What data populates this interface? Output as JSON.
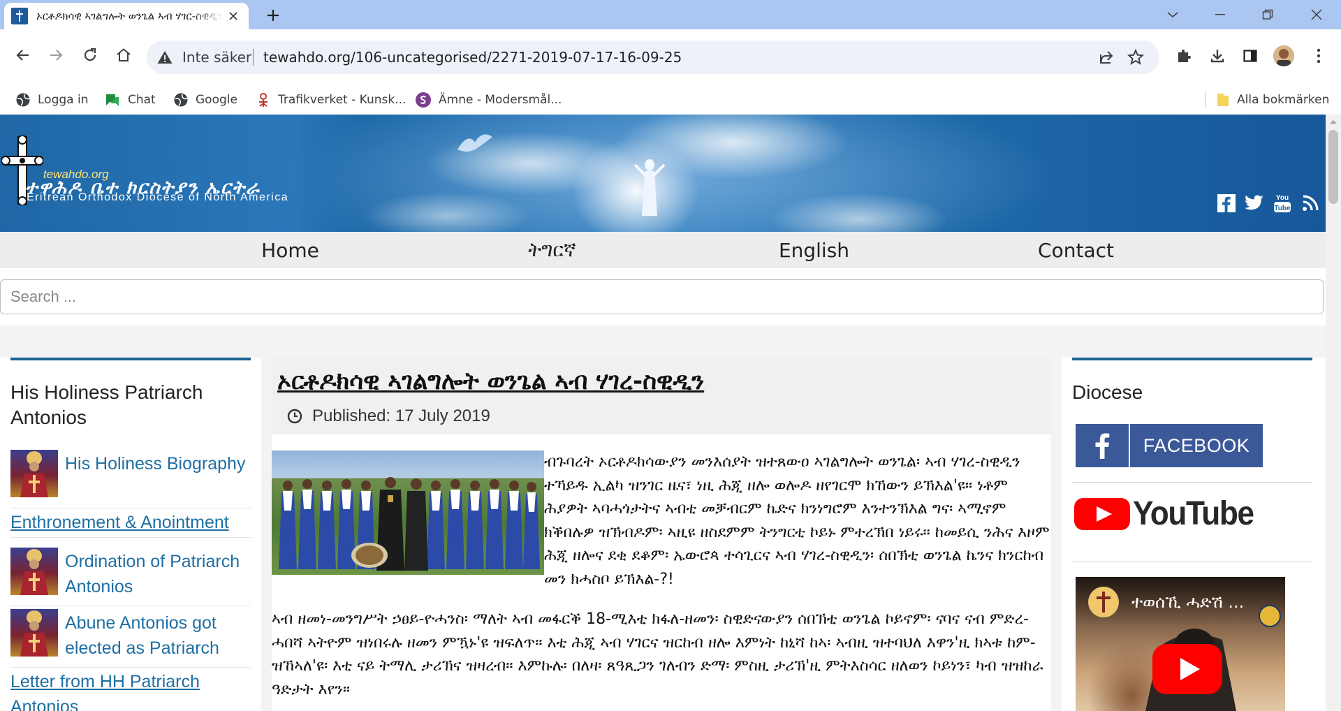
{
  "browser": {
    "tab_title": "ኦርቶዶክሳዊ ኣገልግሎት ወንጌል ኣብ ሃገር-ስዊዲን",
    "omnibox": {
      "security_label": "Inte säker",
      "url": "tewahdo.org/106-uncategorised/2271-2019-07-17-16-09-25"
    },
    "bookmarks": [
      {
        "label": "Logga in",
        "icon": "globe-icon"
      },
      {
        "label": "Chat",
        "icon": "chat-icon"
      },
      {
        "label": "Google",
        "icon": "globe-icon"
      },
      {
        "label": "Trafikverket - Kunsk...",
        "icon": "trafikverket-icon"
      },
      {
        "label": "Ämne - Modersmål...",
        "icon": "s-logo-icon"
      }
    ],
    "all_bookmarks_label": "Alla bokmärken"
  },
  "site": {
    "logo_site": "tewahdo.org",
    "logo_geez": "ተዋሕዶ ቤተ ክርስትያን ኤርትራ",
    "logo_english": "Eritrean Orthodox Diocese of North America",
    "nav": [
      "Home",
      "ትግርኛ",
      "English",
      "Contact"
    ],
    "search_placeholder": "Search ..."
  },
  "left_sidebar": {
    "title": "His Holiness Patriarch Antonios",
    "items": [
      {
        "label": "His Holiness Biography"
      },
      {
        "label": "Enthronement & Anointment"
      },
      {
        "label": "Ordination of Patriarch Antonios"
      },
      {
        "label": "Abune Antonios got elected as Patriarch"
      },
      {
        "label": "Letter from HH Patriarch Antonios"
      }
    ]
  },
  "article": {
    "title": "ኦርቶዶክሳዊ ኣገልግሎት ወንጌል ኣብ ሃገረ-ስዊዲን",
    "published": "Published: 17 July 2019",
    "paragraph1": "ብጉባረት ኦርቶዶክሳውያን መንእሰያት ዝተጸውዐ ኣገልግሎት ወንጌል፡ ኣብ ሃገረ-ስዊዲን ተኻይዱ ኢልካ ዝንገር ዜና፣ ነዚ ሕጂ ዘሎ ወሎዶ ዘየገርሞ ክኸውን ይኽእል'ዩ። ነቶም ሕያዎት ኣባሓጎታትና ኣብቲ መቓብርም ኬድና ክንነግሮም እንተንኽእል ግና፡ ኣሚኖም ክቕበሉዎ ዝኽብዶም፡ ኣዚዩ ዘስደምም ትንግርቲ ኮይኑ ምተረኽበ ነይሩ። ከመይሲ ንሕና እዞም ሕጂ ዘሎና ደቂ ደቆም፡ ኤውሮጳ ተሳጊርና ኣብ ሃገረ-ስዊዲን፡ ሰበኽቲ ወንጌል ኬንና ክንርከብ መን ክሓስቦ ይኽእል-?!",
    "paragraph2": "ኣብ ዘመነ-መንግሥት ኃፀይ-ዮሓንስ፡ ማለት ኣብ መፋርቕ 18-ሚእቲ ክፋለ-ዘመን፡ ስዊድናውያን ሰበኽቲ ወንጌል ኮይኖም፡ ናባና ናብ ምድረ-ሓበሻ ኣትዮም ዝነበሩሉ ዘመን ምዃኑ'ዩ ዝፍለጥ። እቲ ሕጂ ኣብ ሃገርና ዝርከብ ዘሎ እምነት ከኒሻ ከኣ፡ ኣብዚ ዝተባህለ እዋን'ዚ ክኣቱ ከም-ዝኸኣለ'ዩ፡ እቲ ናይ ትማሊ ታሪኽና ዝዛረብ። እምኩሉ፡ በለዛ፡ ጸዓጺጋን ገለብን ድማ፡ ምስዚ ታሪኽ'ዚ ምትእስሳር ዘለወን ኮይነን፣ ካብ ዝዝከራ ዓድታት እየን።"
  },
  "right_sidebar": {
    "title": "Diocese",
    "facebook_label": "FACEBOOK",
    "youtube_label": "YouTube",
    "video_title": "ተወሰኺ ሓድሽ ..."
  },
  "colors": {
    "tab_strip": "#abc6f0",
    "banner_blue": "#1e6aa9",
    "nav_bg": "#ededed",
    "link": "#1f6fa3",
    "sidebar_bar": "#1d6393",
    "facebook": "#3b5998",
    "youtube_red": "#ff0000"
  }
}
